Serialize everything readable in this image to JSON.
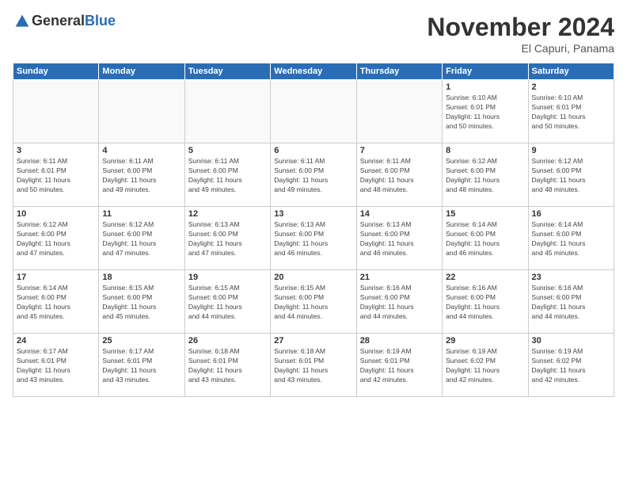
{
  "logo": {
    "general": "General",
    "blue": "Blue"
  },
  "title": "November 2024",
  "subtitle": "El Capuri, Panama",
  "weekdays": [
    "Sunday",
    "Monday",
    "Tuesday",
    "Wednesday",
    "Thursday",
    "Friday",
    "Saturday"
  ],
  "weeks": [
    [
      {
        "day": "",
        "info": ""
      },
      {
        "day": "",
        "info": ""
      },
      {
        "day": "",
        "info": ""
      },
      {
        "day": "",
        "info": ""
      },
      {
        "day": "",
        "info": ""
      },
      {
        "day": "1",
        "info": "Sunrise: 6:10 AM\nSunset: 6:01 PM\nDaylight: 11 hours\nand 50 minutes."
      },
      {
        "day": "2",
        "info": "Sunrise: 6:10 AM\nSunset: 6:01 PM\nDaylight: 11 hours\nand 50 minutes."
      }
    ],
    [
      {
        "day": "3",
        "info": "Sunrise: 6:11 AM\nSunset: 6:01 PM\nDaylight: 11 hours\nand 50 minutes."
      },
      {
        "day": "4",
        "info": "Sunrise: 6:11 AM\nSunset: 6:00 PM\nDaylight: 11 hours\nand 49 minutes."
      },
      {
        "day": "5",
        "info": "Sunrise: 6:11 AM\nSunset: 6:00 PM\nDaylight: 11 hours\nand 49 minutes."
      },
      {
        "day": "6",
        "info": "Sunrise: 6:11 AM\nSunset: 6:00 PM\nDaylight: 11 hours\nand 49 minutes."
      },
      {
        "day": "7",
        "info": "Sunrise: 6:11 AM\nSunset: 6:00 PM\nDaylight: 11 hours\nand 48 minutes."
      },
      {
        "day": "8",
        "info": "Sunrise: 6:12 AM\nSunset: 6:00 PM\nDaylight: 11 hours\nand 48 minutes."
      },
      {
        "day": "9",
        "info": "Sunrise: 6:12 AM\nSunset: 6:00 PM\nDaylight: 11 hours\nand 48 minutes."
      }
    ],
    [
      {
        "day": "10",
        "info": "Sunrise: 6:12 AM\nSunset: 6:00 PM\nDaylight: 11 hours\nand 47 minutes."
      },
      {
        "day": "11",
        "info": "Sunrise: 6:12 AM\nSunset: 6:00 PM\nDaylight: 11 hours\nand 47 minutes."
      },
      {
        "day": "12",
        "info": "Sunrise: 6:13 AM\nSunset: 6:00 PM\nDaylight: 11 hours\nand 47 minutes."
      },
      {
        "day": "13",
        "info": "Sunrise: 6:13 AM\nSunset: 6:00 PM\nDaylight: 11 hours\nand 46 minutes."
      },
      {
        "day": "14",
        "info": "Sunrise: 6:13 AM\nSunset: 6:00 PM\nDaylight: 11 hours\nand 46 minutes."
      },
      {
        "day": "15",
        "info": "Sunrise: 6:14 AM\nSunset: 6:00 PM\nDaylight: 11 hours\nand 46 minutes."
      },
      {
        "day": "16",
        "info": "Sunrise: 6:14 AM\nSunset: 6:00 PM\nDaylight: 11 hours\nand 45 minutes."
      }
    ],
    [
      {
        "day": "17",
        "info": "Sunrise: 6:14 AM\nSunset: 6:00 PM\nDaylight: 11 hours\nand 45 minutes."
      },
      {
        "day": "18",
        "info": "Sunrise: 6:15 AM\nSunset: 6:00 PM\nDaylight: 11 hours\nand 45 minutes."
      },
      {
        "day": "19",
        "info": "Sunrise: 6:15 AM\nSunset: 6:00 PM\nDaylight: 11 hours\nand 44 minutes."
      },
      {
        "day": "20",
        "info": "Sunrise: 6:15 AM\nSunset: 6:00 PM\nDaylight: 11 hours\nand 44 minutes."
      },
      {
        "day": "21",
        "info": "Sunrise: 6:16 AM\nSunset: 6:00 PM\nDaylight: 11 hours\nand 44 minutes."
      },
      {
        "day": "22",
        "info": "Sunrise: 6:16 AM\nSunset: 6:00 PM\nDaylight: 11 hours\nand 44 minutes."
      },
      {
        "day": "23",
        "info": "Sunrise: 6:16 AM\nSunset: 6:00 PM\nDaylight: 11 hours\nand 44 minutes."
      }
    ],
    [
      {
        "day": "24",
        "info": "Sunrise: 6:17 AM\nSunset: 6:01 PM\nDaylight: 11 hours\nand 43 minutes."
      },
      {
        "day": "25",
        "info": "Sunrise: 6:17 AM\nSunset: 6:01 PM\nDaylight: 11 hours\nand 43 minutes."
      },
      {
        "day": "26",
        "info": "Sunrise: 6:18 AM\nSunset: 6:01 PM\nDaylight: 11 hours\nand 43 minutes."
      },
      {
        "day": "27",
        "info": "Sunrise: 6:18 AM\nSunset: 6:01 PM\nDaylight: 11 hours\nand 43 minutes."
      },
      {
        "day": "28",
        "info": "Sunrise: 6:19 AM\nSunset: 6:01 PM\nDaylight: 11 hours\nand 42 minutes."
      },
      {
        "day": "29",
        "info": "Sunrise: 6:19 AM\nSunset: 6:02 PM\nDaylight: 11 hours\nand 42 minutes."
      },
      {
        "day": "30",
        "info": "Sunrise: 6:19 AM\nSunset: 6:02 PM\nDaylight: 11 hours\nand 42 minutes."
      }
    ]
  ]
}
